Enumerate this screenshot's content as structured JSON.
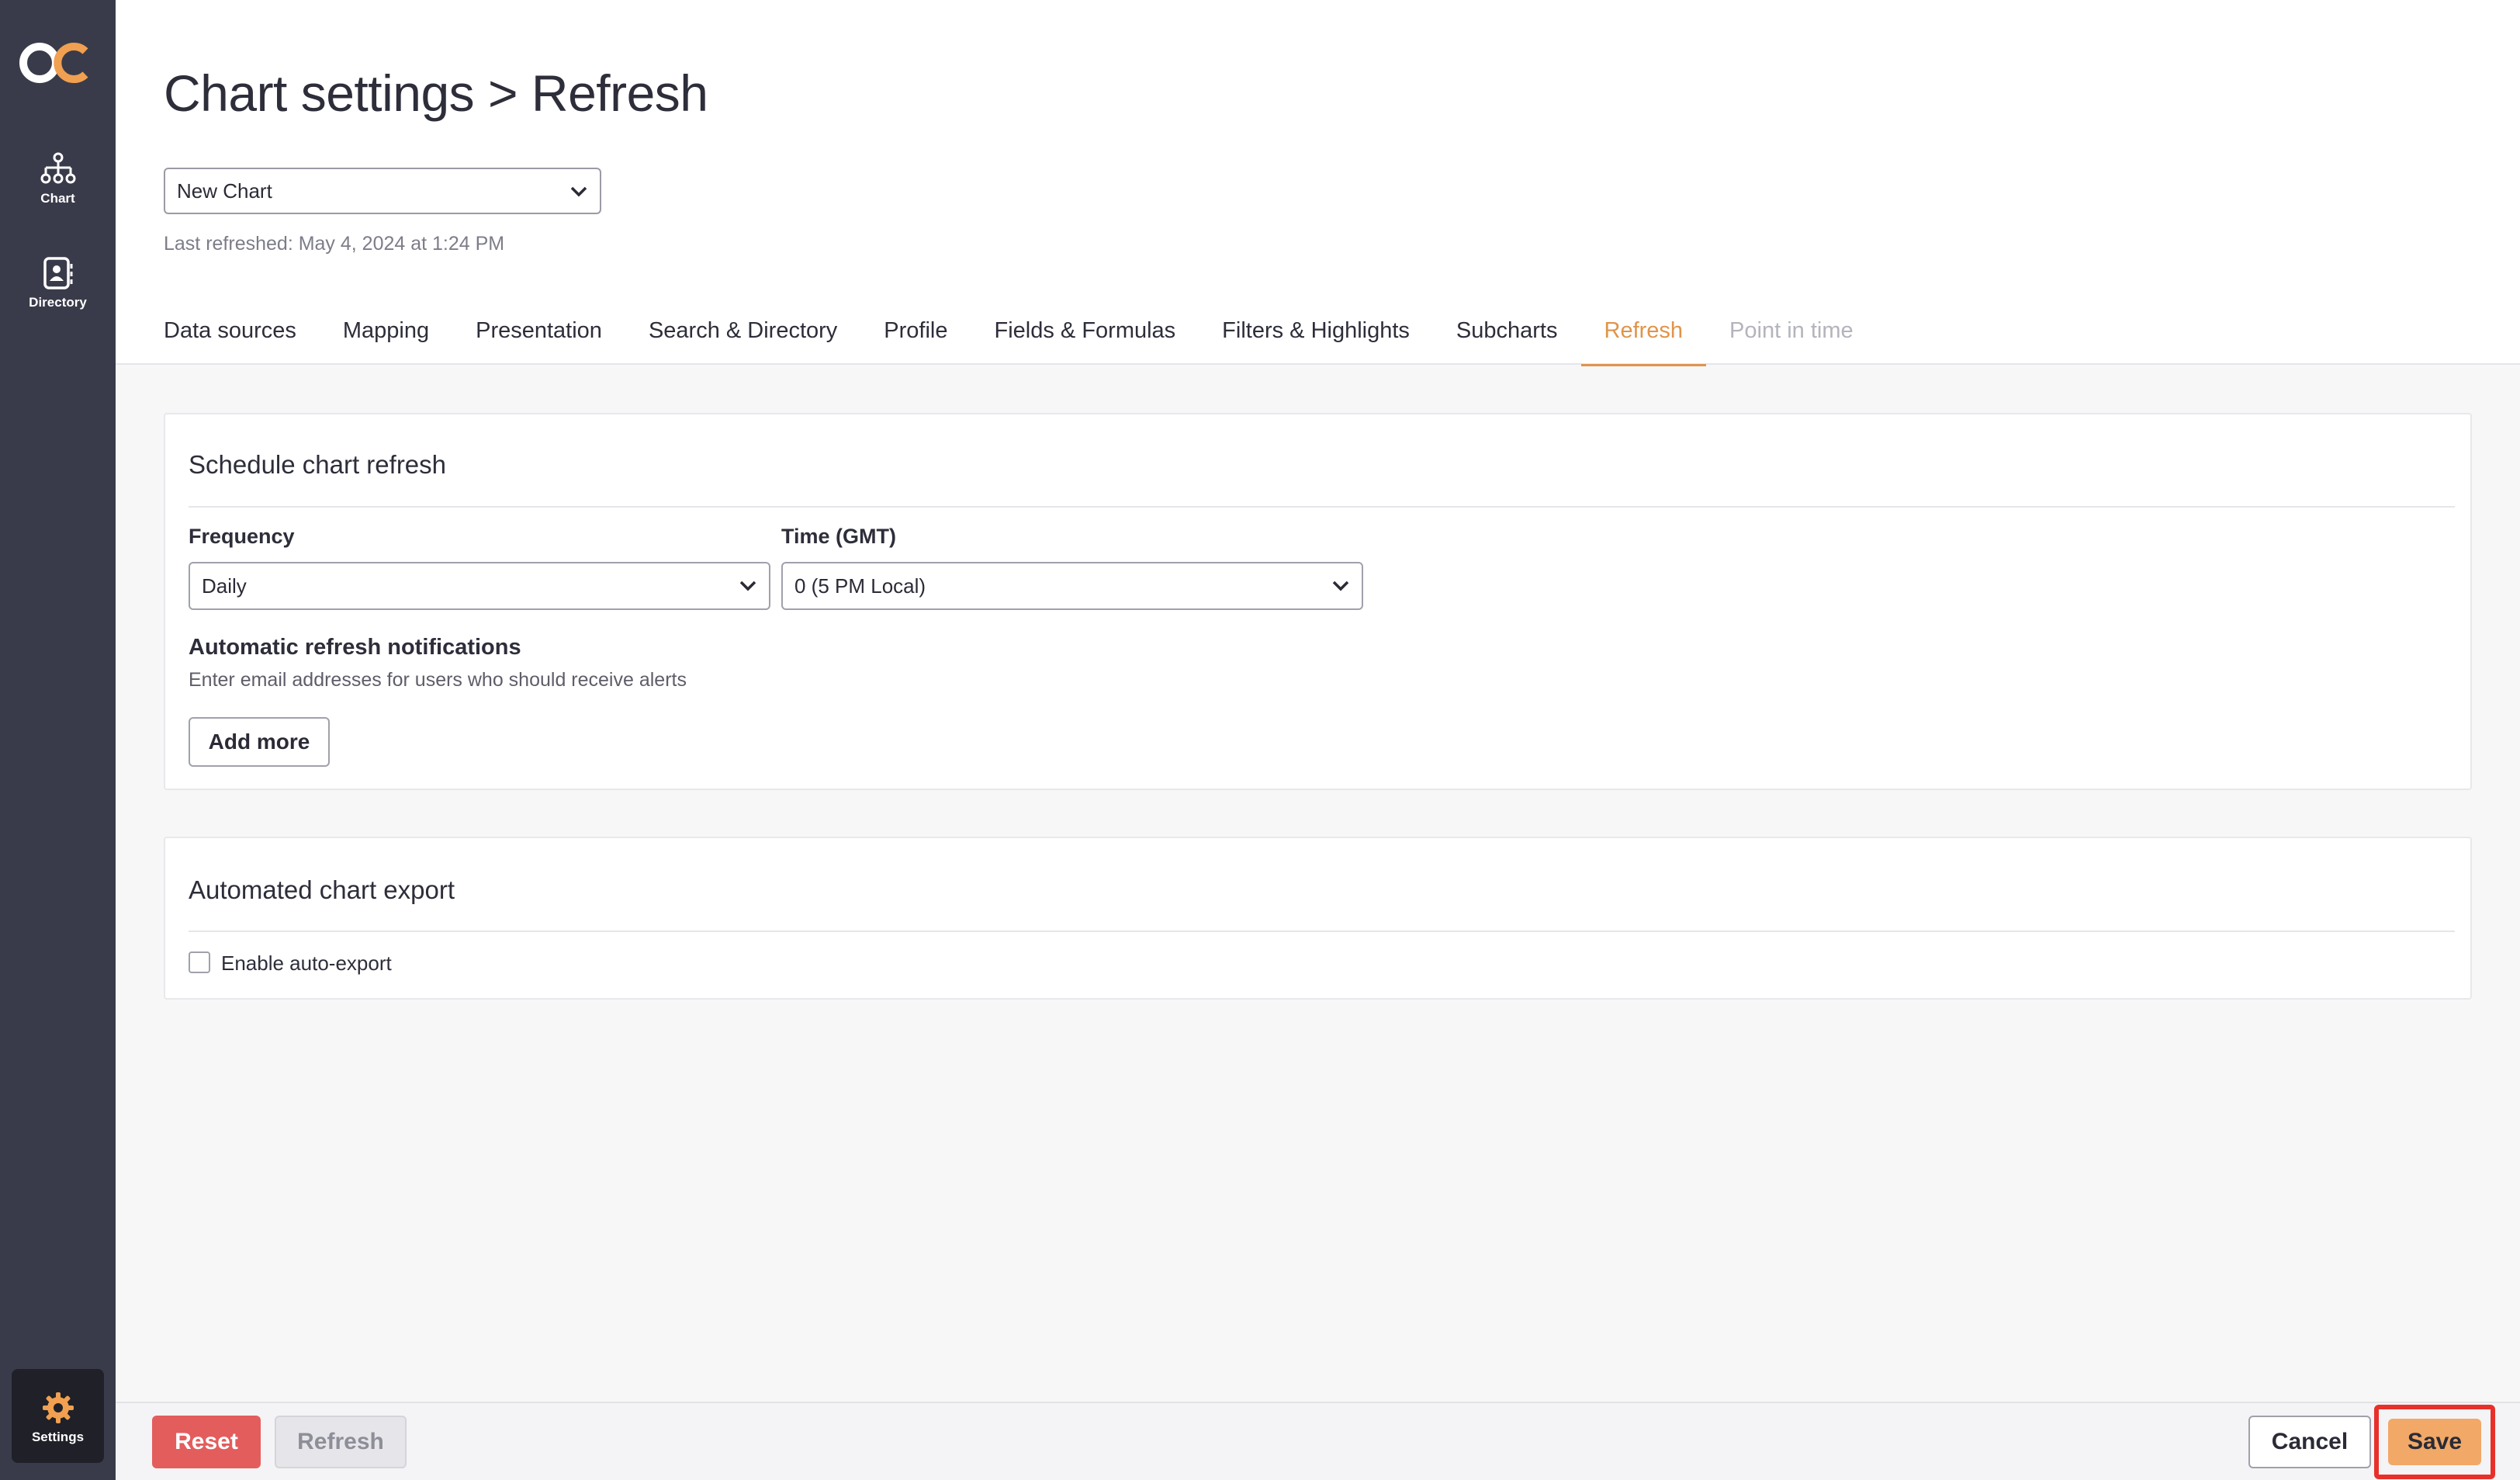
{
  "sidebar": {
    "logo": "OC",
    "items": [
      {
        "label": "Chart",
        "icon": "org-chart-icon"
      },
      {
        "label": "Directory",
        "icon": "contact-book-icon"
      },
      {
        "label": "Settings",
        "icon": "gear-icon"
      }
    ]
  },
  "header": {
    "title": "Chart settings > Refresh",
    "chart_select_value": "New Chart",
    "last_refreshed": "Last refreshed: May 4, 2024 at 1:24 PM",
    "tabs": [
      {
        "label": "Data sources"
      },
      {
        "label": "Mapping"
      },
      {
        "label": "Presentation"
      },
      {
        "label": "Search & Directory"
      },
      {
        "label": "Profile"
      },
      {
        "label": "Fields & Formulas"
      },
      {
        "label": "Filters & Highlights"
      },
      {
        "label": "Subcharts"
      },
      {
        "label": "Refresh",
        "state": "active"
      },
      {
        "label": "Point in time",
        "state": "disabled"
      }
    ]
  },
  "schedule": {
    "title": "Schedule chart refresh",
    "frequency_label": "Frequency",
    "frequency_value": "Daily",
    "time_label": "Time (GMT)",
    "time_value": "0 (5 PM Local)",
    "notifications_title": "Automatic refresh notifications",
    "notifications_desc": "Enter email addresses for users who should receive alerts",
    "add_more_label": "Add more"
  },
  "export": {
    "title": "Automated chart export",
    "enable_label": "Enable auto-export",
    "enabled": false
  },
  "footer": {
    "reset_label": "Reset",
    "refresh_label": "Refresh",
    "cancel_label": "Cancel",
    "save_label": "Save"
  },
  "colors": {
    "sidebar": "#3a3b4a",
    "accent": "#e0944a",
    "reset": "#e35d5d",
    "save": "#f2a867",
    "highlight": "#e8302a"
  }
}
